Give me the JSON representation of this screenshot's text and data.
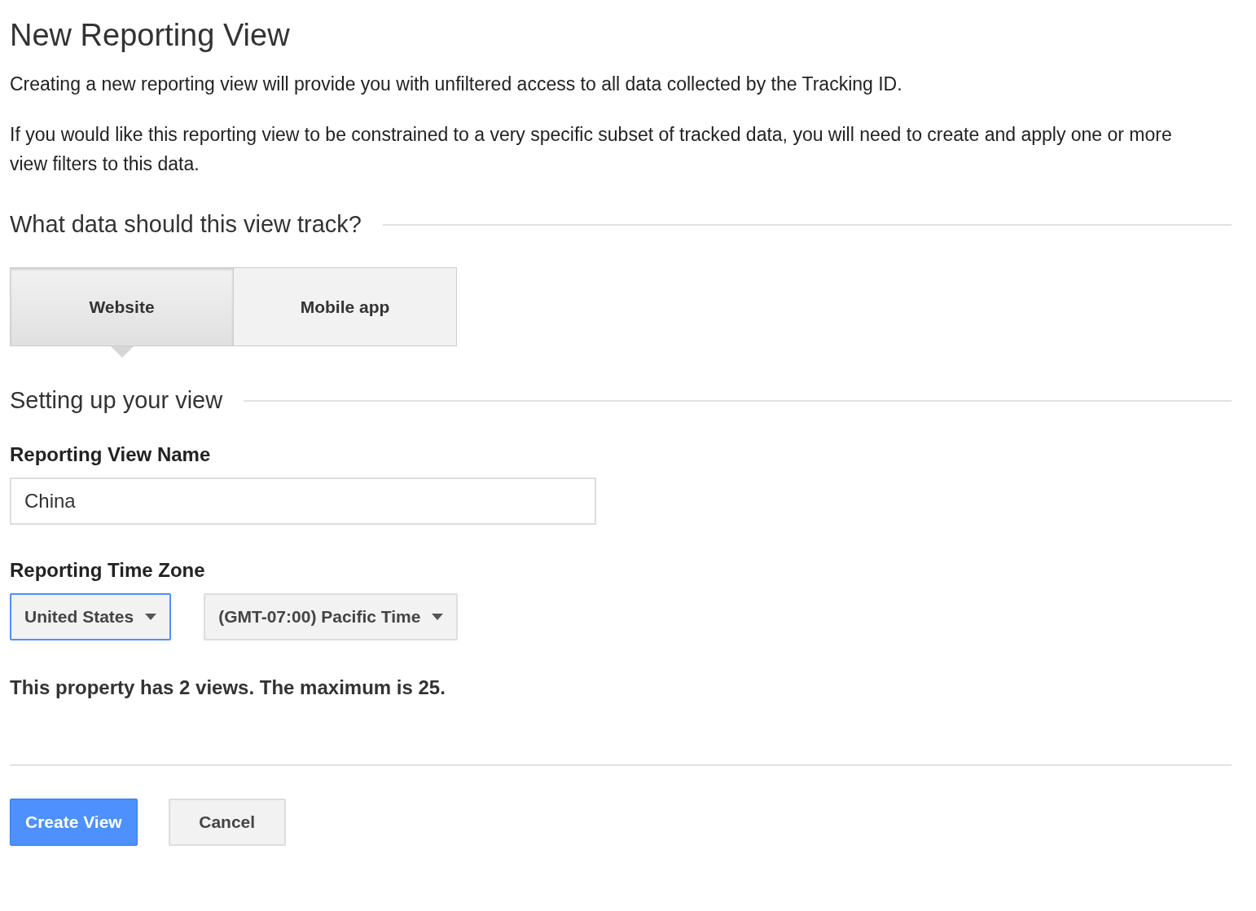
{
  "title": "New Reporting View",
  "paragraphs": [
    "Creating a new reporting view will provide you with unfiltered access to all data collected by the Tracking ID.",
    "If you would like this reporting view to be constrained to a very specific subset of tracked data, you will need to create and apply one or more view filters to this data."
  ],
  "track_section": {
    "heading": "What data should this view track?",
    "options": [
      {
        "label": "Website",
        "selected": true
      },
      {
        "label": "Mobile app",
        "selected": false
      }
    ]
  },
  "setup_section": {
    "heading": "Setting up your view",
    "name_field": {
      "label": "Reporting View Name",
      "value": "China"
    },
    "time_zone": {
      "label": "Reporting Time Zone",
      "dropdowns": [
        {
          "value": "United States",
          "focused": true
        },
        {
          "value": "(GMT-07:00) Pacific Time",
          "focused": false
        }
      ]
    },
    "note": "This property has 2 views. The maximum is 25."
  },
  "buttons": [
    {
      "label": "Create View",
      "kind": "primary"
    },
    {
      "label": "Cancel",
      "kind": "secondary"
    }
  ]
}
